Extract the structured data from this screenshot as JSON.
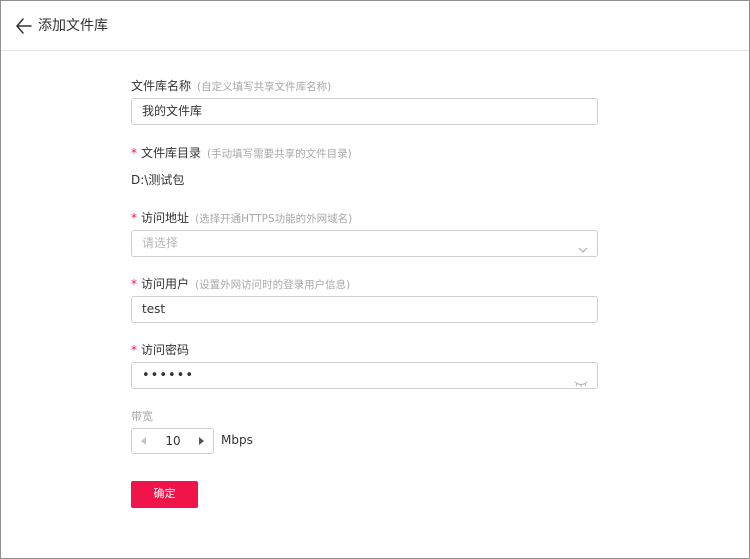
{
  "header": {
    "title": "添加文件库"
  },
  "form": {
    "name": {
      "label": "文件库名称",
      "hint": "(自定义填写共享文件库名称)",
      "value": "我的文件库"
    },
    "dir": {
      "required": "*",
      "label": "文件库目录",
      "hint": "(手动填写需要共享的文件目录)",
      "value": "D:\\测试包"
    },
    "address": {
      "required": "*",
      "label": "访问地址",
      "hint": "(选择开通HTTPS功能的外网域名)",
      "placeholder": "请选择"
    },
    "user": {
      "required": "*",
      "label": "访问用户",
      "hint": "(设置外网访问时的登录用户信息)",
      "value": "test"
    },
    "password": {
      "required": "*",
      "label": "访问密码",
      "value": "••••••"
    },
    "bandwidth": {
      "label": "带宽",
      "value": "10",
      "unit": "Mbps"
    },
    "submit_label": "确定"
  },
  "colors": {
    "accent": "#f0144a",
    "border": "#cfcfcf",
    "hint": "#a8a8a8"
  },
  "icons": {
    "back": "arrow-left-icon",
    "select": "chevron-down-icon",
    "password": "eye-closed-icon",
    "dec": "triangle-left-icon",
    "inc": "triangle-right-icon"
  }
}
